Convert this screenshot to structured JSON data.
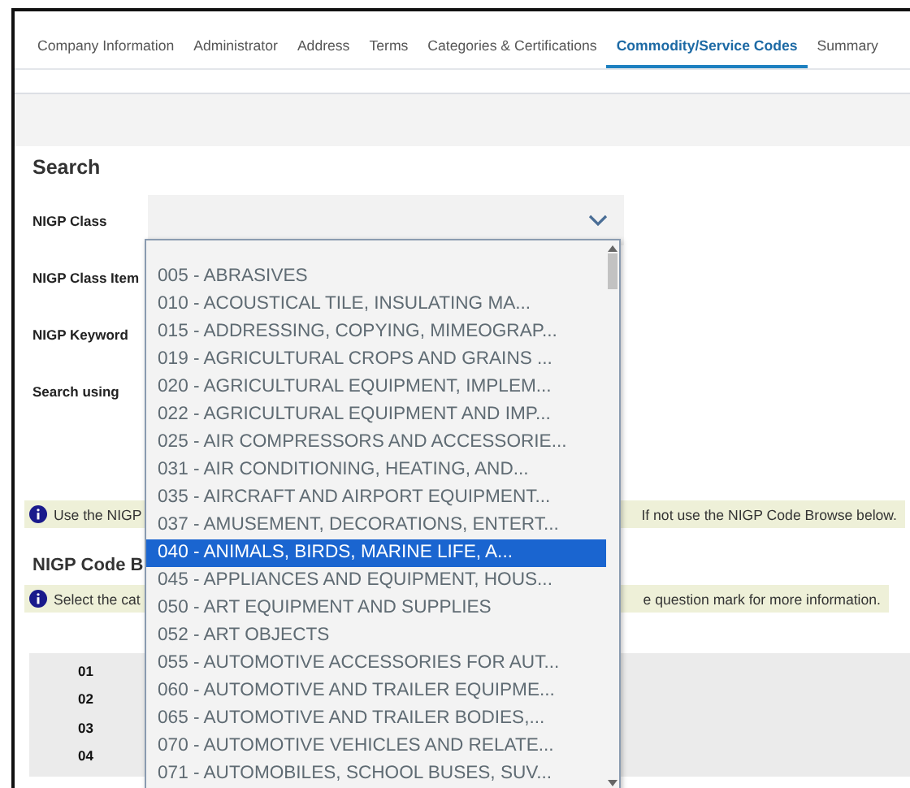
{
  "tabs": [
    {
      "label": "Company Information",
      "selected": false
    },
    {
      "label": "Administrator",
      "selected": false
    },
    {
      "label": "Address",
      "selected": false
    },
    {
      "label": "Terms",
      "selected": false
    },
    {
      "label": "Categories & Certifications",
      "selected": false
    },
    {
      "label": "Commodity/Service Codes",
      "selected": true
    },
    {
      "label": "Summary",
      "selected": false
    }
  ],
  "search": {
    "heading": "Search",
    "fields": [
      {
        "label": "NIGP Class",
        "kind": "select"
      },
      {
        "label": "NIGP Class Item",
        "kind": "label"
      },
      {
        "label": "NIGP Keyword",
        "kind": "label"
      },
      {
        "label": "Search using",
        "kind": "label"
      }
    ]
  },
  "dropdown": {
    "options": [
      {
        "label": "005 - ABRASIVES",
        "selected": false
      },
      {
        "label": "010 - ACOUSTICAL TILE, INSULATING MA...",
        "selected": false
      },
      {
        "label": "015 - ADDRESSING, COPYING, MIMEOGRAP...",
        "selected": false
      },
      {
        "label": "019 - AGRICULTURAL CROPS AND GRAINS ...",
        "selected": false
      },
      {
        "label": "020 - AGRICULTURAL EQUIPMENT, IMPLEM...",
        "selected": false
      },
      {
        "label": "022 - AGRICULTURAL EQUIPMENT AND IMP...",
        "selected": false
      },
      {
        "label": "025 - AIR COMPRESSORS AND ACCESSORIE...",
        "selected": false
      },
      {
        "label": "031 - AIR CONDITIONING, HEATING, AND...",
        "selected": false
      },
      {
        "label": "035 - AIRCRAFT AND AIRPORT EQUIPMENT...",
        "selected": false
      },
      {
        "label": "037 - AMUSEMENT, DECORATIONS, ENTERT...",
        "selected": false
      },
      {
        "label": "040 - ANIMALS, BIRDS, MARINE LIFE, A...",
        "selected": true
      },
      {
        "label": "045 - APPLIANCES AND EQUIPMENT, HOUS...",
        "selected": false
      },
      {
        "label": "050 - ART EQUIPMENT AND SUPPLIES",
        "selected": false
      },
      {
        "label": "052 - ART OBJECTS",
        "selected": false
      },
      {
        "label": "055 - AUTOMOTIVE ACCESSORIES FOR AUT...",
        "selected": false
      },
      {
        "label": "060 - AUTOMOTIVE AND TRAILER EQUIPME...",
        "selected": false
      },
      {
        "label": "065 - AUTOMOTIVE AND TRAILER BODIES,...",
        "selected": false
      },
      {
        "label": "070 - AUTOMOTIVE VEHICLES AND RELATE...",
        "selected": false
      },
      {
        "label": "071 - AUTOMOBILES, SCHOOL BUSES, SUV...",
        "selected": false
      }
    ]
  },
  "info_bar_1": {
    "left": "Use the NIGP",
    "right": "If not use the NIGP Code Browse below."
  },
  "browse": {
    "heading": "NIGP Code B",
    "info_bar": {
      "left": "Select the cat",
      "right": "e question mark for more information."
    },
    "codes": [
      "01",
      "02",
      "03",
      "04"
    ]
  }
}
